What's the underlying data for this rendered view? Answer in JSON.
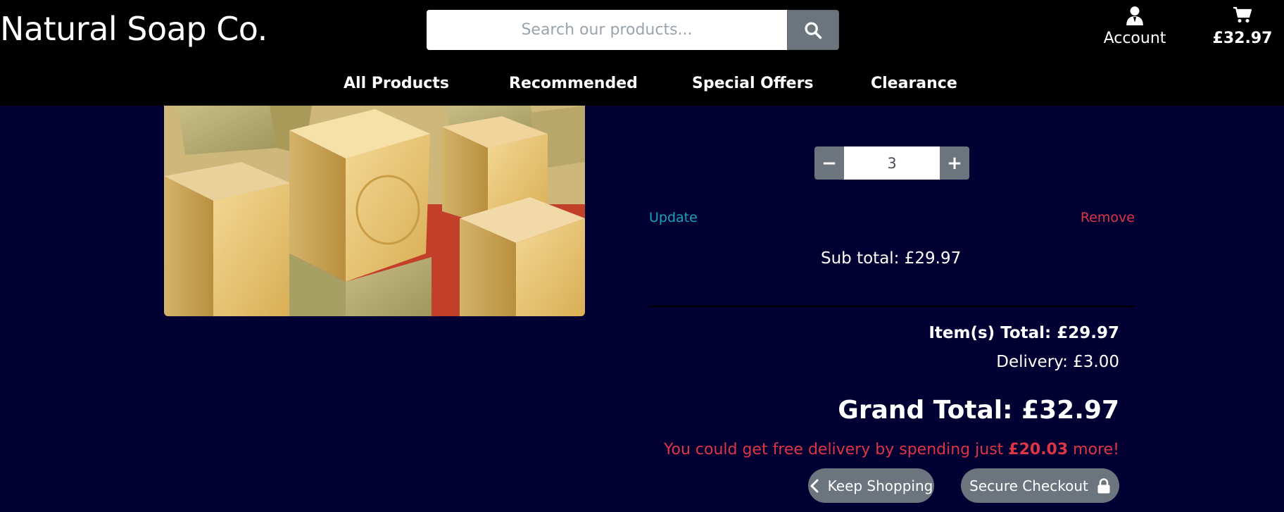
{
  "header": {
    "brand": "Natural Soap Co.",
    "search": {
      "placeholder": "Search our products...",
      "icon": "search-icon"
    },
    "account": {
      "label": "Account",
      "icon": "user-icon"
    },
    "cart": {
      "total": "£32.97",
      "icon": "shopping-cart-icon"
    }
  },
  "nav": {
    "items": [
      {
        "label": "All Products"
      },
      {
        "label": "Recommended"
      },
      {
        "label": "Special Offers"
      },
      {
        "label": "Clearance"
      }
    ]
  },
  "product": {
    "image_alt": "Savon de Marseille soap cubes",
    "quantity": "3",
    "minus_icon": "minus-icon",
    "plus_icon": "plus-icon",
    "update_label": "Update",
    "remove_label": "Remove",
    "subtotal": "Sub total: £29.97"
  },
  "summary": {
    "items_total": "Item(s) Total: £29.97",
    "delivery": "Delivery: £3.00",
    "grand_total": "Grand Total: £32.97",
    "free_delivery_prefix": "You could get free delivery by spending just ",
    "free_delivery_amount": "£20.03",
    "free_delivery_suffix": " more!"
  },
  "actions": {
    "keep_shopping": "Keep Shopping",
    "secure_checkout": "Secure Checkout"
  },
  "colors": {
    "page_bg": "#020033",
    "header_bg": "#000000",
    "button_grey": "#6c757d",
    "link_info": "#17a2b8",
    "link_danger": "#dc3545"
  }
}
